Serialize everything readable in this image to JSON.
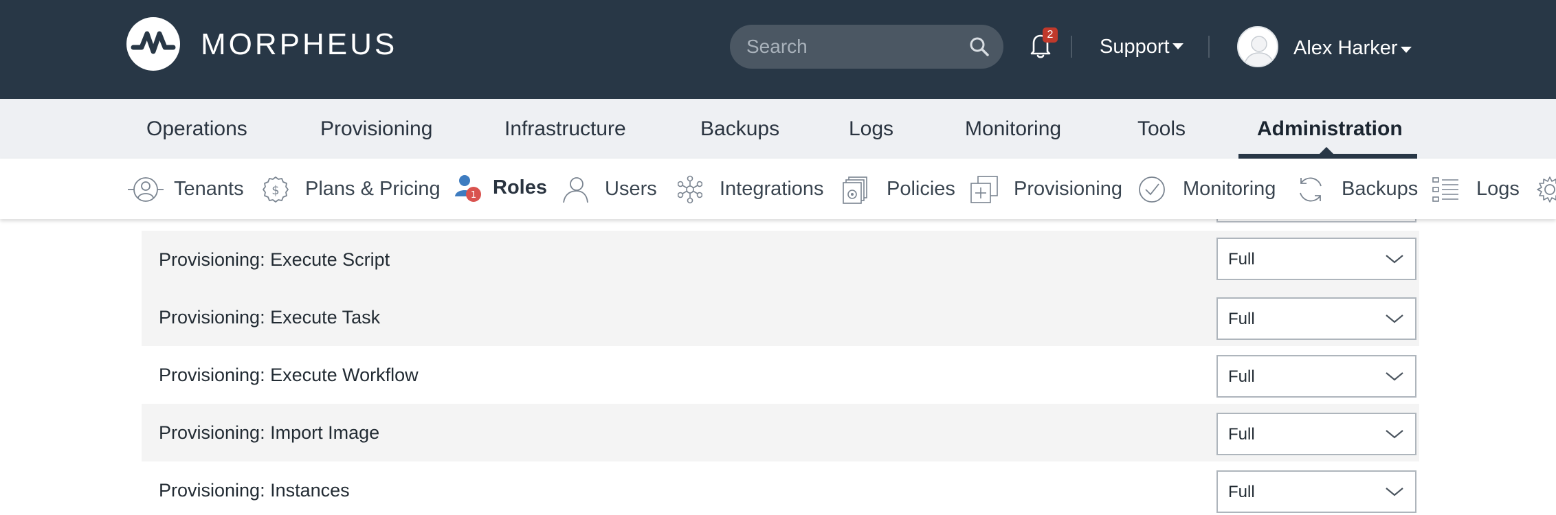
{
  "header": {
    "brand": "MORPHEUS",
    "search": {
      "placeholder": "Search"
    },
    "notifications": {
      "count": "2"
    },
    "support_label": "Support",
    "user_name": "Alex Harker"
  },
  "main_nav": {
    "items": [
      {
        "label": "Operations"
      },
      {
        "label": "Provisioning"
      },
      {
        "label": "Infrastructure"
      },
      {
        "label": "Backups"
      },
      {
        "label": "Logs"
      },
      {
        "label": "Monitoring"
      },
      {
        "label": "Tools"
      },
      {
        "label": "Administration",
        "active": true
      }
    ]
  },
  "sub_nav": {
    "items": [
      {
        "label": "Tenants",
        "icon": "tenants-icon"
      },
      {
        "label": "Plans & Pricing",
        "icon": "pricing-icon"
      },
      {
        "label": "Roles",
        "icon": "roles-icon",
        "active": true
      },
      {
        "label": "Users",
        "icon": "users-icon"
      },
      {
        "label": "Integrations",
        "icon": "integrations-icon"
      },
      {
        "label": "Policies",
        "icon": "policies-icon"
      },
      {
        "label": "Provisioning",
        "icon": "provisioning-icon"
      },
      {
        "label": "Monitoring",
        "icon": "monitoring-icon"
      },
      {
        "label": "Backups",
        "icon": "backups-icon"
      },
      {
        "label": "Logs",
        "icon": "logs-icon"
      },
      {
        "label": "",
        "icon": "settings-icon"
      }
    ]
  },
  "permissions": {
    "rows": [
      {
        "name": "Provisioning: Execute Script",
        "value": "Full"
      },
      {
        "name": "Provisioning: Execute Task",
        "value": "Full"
      },
      {
        "name": "Provisioning: Execute Workflow",
        "value": "Full"
      },
      {
        "name": "Provisioning: Import Image",
        "value": "Full"
      },
      {
        "name": "Provisioning: Instances",
        "value": "Full"
      }
    ]
  },
  "colors": {
    "header_bg": "#283746",
    "nav_bg": "#eef0f3",
    "badge": "#c0392b",
    "row_shade": "#f4f4f4"
  }
}
